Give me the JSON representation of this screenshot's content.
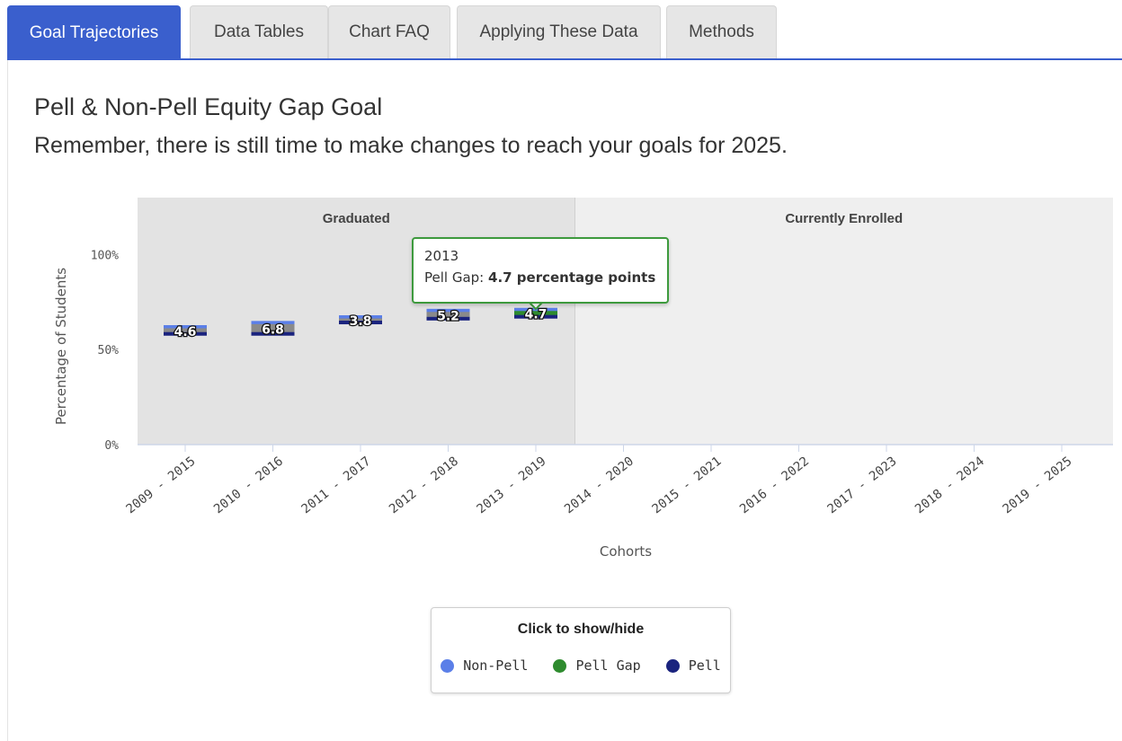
{
  "tabs": [
    {
      "label": "Goal Trajectories",
      "active": true
    },
    {
      "label": "Data Tables",
      "active": false
    },
    {
      "label": "Chart FAQ",
      "active": false
    },
    {
      "label": "Applying These Data",
      "active": false
    },
    {
      "label": "Methods",
      "active": false
    }
  ],
  "page": {
    "title": "Pell & Non-Pell Equity Gap Goal",
    "subtitle": "Remember, there is still time to make changes to reach your goals for 2025."
  },
  "colors": {
    "non_pell": "#5b7fe8",
    "pell_gap": "#2e8b2e",
    "pell": "#1a237e",
    "accent": "#3a5fcd",
    "graduated_band": "#e3e3e3",
    "enrolled_band": "#efefef"
  },
  "chart_data": {
    "type": "bar",
    "xlabel": "Cohorts",
    "ylabel": "Percentage of Students",
    "ylim": [
      0,
      130
    ],
    "yticks": [
      {
        "value": 0,
        "label": "0%"
      },
      {
        "value": 50,
        "label": "50%"
      },
      {
        "value": 100,
        "label": "100%"
      }
    ],
    "categories": [
      "2009 - 2015",
      "2010 - 2016",
      "2011 - 2017",
      "2012 - 2018",
      "2013 - 2019",
      "2014 - 2020",
      "2015 - 2021",
      "2016 - 2022",
      "2017 - 2023",
      "2018 - 2024",
      "2019 - 2025"
    ],
    "bands": [
      {
        "label": "Graduated",
        "from_index": 0,
        "to_index": 4
      },
      {
        "label": "Currently Enrolled",
        "from_index": 5,
        "to_index": 10
      }
    ],
    "series": [
      {
        "name": "Non-Pell",
        "values": [
          62.4,
          64.6,
          67.6,
          71.0,
          71.5,
          null,
          null,
          null,
          null,
          null,
          null
        ]
      },
      {
        "name": "Pell",
        "values": [
          57.8,
          57.8,
          63.8,
          65.8,
          66.8,
          null,
          null,
          null,
          null,
          null,
          null
        ]
      },
      {
        "name": "Pell Gap",
        "values": [
          4.6,
          6.8,
          3.8,
          5.2,
          4.7,
          null,
          null,
          null,
          null,
          null,
          null
        ]
      }
    ],
    "data_labels": [
      "4.6",
      "6.8",
      "3.8",
      "5.2",
      "4.7"
    ],
    "highlighted_index": 4,
    "legend": {
      "title": "Click to show/hide",
      "placement": "bottom-center"
    }
  },
  "legend_items": [
    {
      "label": "Non-Pell"
    },
    {
      "label": "Pell Gap"
    },
    {
      "label": "Pell"
    }
  ],
  "tooltip": {
    "title": "2013",
    "label": "Pell Gap:",
    "value": "4.7 percentage points"
  }
}
